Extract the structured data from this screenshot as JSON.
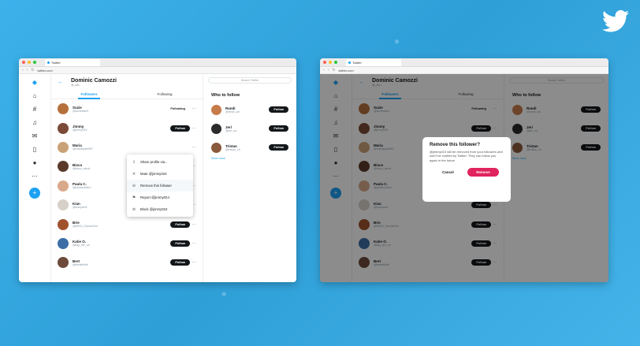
{
  "colors": {
    "background": "#36a9e1",
    "twitter_blue": "#1da1f2",
    "remove_red": "#e0245e"
  },
  "browser": {
    "tab_title": "Twitter",
    "url": "twitter.com"
  },
  "profile": {
    "name": "Dominic Camozzi",
    "handle": "@_dm..."
  },
  "tabs": {
    "followers": "Followers",
    "following": "Following"
  },
  "search_placeholder": "Search Twitter",
  "who_to_follow": {
    "title": "Who to follow",
    "items": [
      {
        "name": "Randi",
        "handle": "@randi_cal",
        "button": "Follow",
        "color": "#c77b4b"
      },
      {
        "name": "Jeri",
        "handle": "@jeri_eq",
        "button": "Follow",
        "color": "#2b2b2b"
      },
      {
        "name": "Tristan",
        "handle": "@tristan_ch",
        "button": "Follow",
        "color": "#8a5a3c"
      }
    ],
    "show_more": "Show more"
  },
  "left_followers": [
    {
      "name": "Suzie",
      "handle": "@suziecame",
      "button": "Following",
      "color": "#b5703c"
    },
    {
      "name": "Jimmy",
      "handle": "@jimmy024",
      "button": "Follow",
      "color": "#7a4a36"
    },
    {
      "name": "Maria",
      "handle": "@mariarpark087",
      "button": "",
      "color": "#caa278"
    },
    {
      "name": "Bisco",
      "handle": "@bisco_cards",
      "button": "",
      "color": "#5b3a2a"
    },
    {
      "name": "Paula C.",
      "handle": "@paulacarlson",
      "button": "",
      "color": "#d8a98a"
    },
    {
      "name": "Kian",
      "handle": "@kianyame",
      "button": "",
      "color": "#d7d0c8"
    },
    {
      "name": "Brie",
      "handle": "@BRnD_DonutsFan",
      "button": "Follow",
      "color": "#a0522d"
    },
    {
      "name": "Katie O.",
      "handle": "@kay_tee_oh",
      "button": "Follow",
      "color": "#3b6ea5"
    },
    {
      "name": "Bert",
      "handle": "@bertiefluffs",
      "button": "Follow",
      "color": "#6e4a3a"
    }
  ],
  "right_followers": [
    {
      "name": "Suzie",
      "handle": "@suziecame",
      "button": "Following",
      "color": "#b5703c"
    },
    {
      "name": "Jimmy",
      "handle": "@jimmy024",
      "button": "Follow",
      "color": "#7a4a36"
    },
    {
      "name": "Maria",
      "handle": "@mariarpark087",
      "button": "",
      "color": "#caa278"
    },
    {
      "name": "Bisco",
      "handle": "@bisco_cards",
      "button": "",
      "color": "#5b3a2a"
    },
    {
      "name": "Paula C.",
      "handle": "@paulacarlson",
      "button": "",
      "color": "#d8a98a"
    },
    {
      "name": "Kian",
      "handle": "@kianyame",
      "button": "Follow",
      "color": "#d7d0c8"
    },
    {
      "name": "Brie",
      "handle": "@BRnD_DonutsFan",
      "button": "Follow",
      "color": "#a0522d"
    },
    {
      "name": "Katie O.",
      "handle": "@kay_tee_oh",
      "button": "Follow",
      "color": "#3b6ea5"
    },
    {
      "name": "Bert",
      "handle": "@bertiefluffs",
      "button": "Follow",
      "color": "#6e4a3a"
    }
  ],
  "context_menu": [
    {
      "icon": "share-icon",
      "label": "Share profile via..."
    },
    {
      "icon": "mute-icon",
      "label": "Mute @jimmy024"
    },
    {
      "icon": "remove-follower-icon",
      "label": "Remove this follower"
    },
    {
      "icon": "flag-icon",
      "label": "Report @jimmy024"
    },
    {
      "icon": "block-icon",
      "label": "Block @jimmy024"
    }
  ],
  "dialog": {
    "title": "Remove this follower?",
    "body": "@jimmy024 will be removed from your followers and won't be notified by Twitter. They can follow you again in the future.",
    "cancel": "Cancel",
    "remove": "Remove"
  }
}
